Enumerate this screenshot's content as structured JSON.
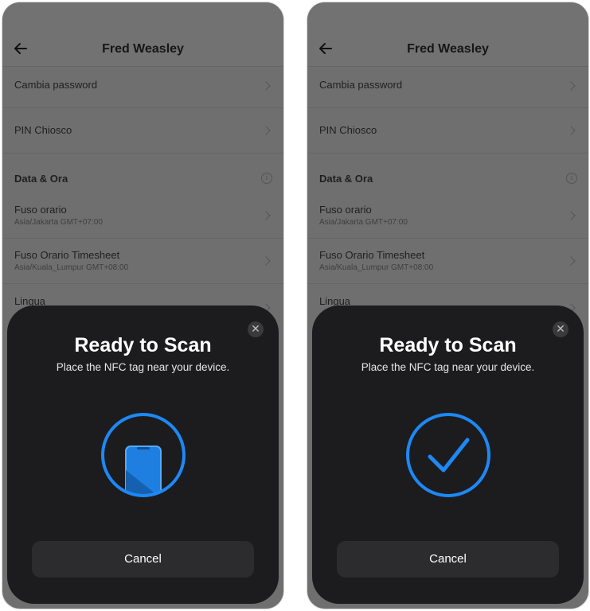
{
  "screens": [
    {
      "header": {
        "title": "Fred Weasley",
        "back_icon": "arrow-left-icon"
      },
      "settings": [
        {
          "label": "Cambia password"
        },
        {
          "label": "PIN Chiosco"
        },
        {
          "section": "Data & Ora",
          "icon": "info-icon"
        },
        {
          "label": "Fuso orario",
          "sub": "Asia/Jakarta GMT+07:00"
        },
        {
          "label": "Fuso Orario Timesheet",
          "sub": "Asia/Kuala_Lumpur GMT+08:00"
        },
        {
          "label": "Lingua"
        }
      ],
      "nfc_sheet": {
        "title": "Ready to Scan",
        "subtitle": "Place the NFC tag near your device.",
        "state": "scanning",
        "icon": "phone-nfc-icon",
        "cancel_label": "Cancel",
        "close_icon": "close-icon"
      }
    },
    {
      "header": {
        "title": "Fred Weasley",
        "back_icon": "arrow-left-icon"
      },
      "settings": [
        {
          "label": "Cambia password"
        },
        {
          "label": "PIN Chiosco"
        },
        {
          "section": "Data & Ora",
          "icon": "info-icon"
        },
        {
          "label": "Fuso orario",
          "sub": "Asia/Jakarta GMT+07:00"
        },
        {
          "label": "Fuso Orario Timesheet",
          "sub": "Asia/Kuala_Lumpur GMT+08:00"
        },
        {
          "label": "Lingua"
        }
      ],
      "nfc_sheet": {
        "title": "Ready to Scan",
        "subtitle": "Place the NFC tag near your device.",
        "state": "success",
        "icon": "checkmark-icon",
        "cancel_label": "Cancel",
        "close_icon": "close-icon"
      }
    }
  ],
  "colors": {
    "accent": "#1e88f5",
    "sheet_bg": "#1c1c1e",
    "dim_overlay": "#6f6f6f"
  }
}
